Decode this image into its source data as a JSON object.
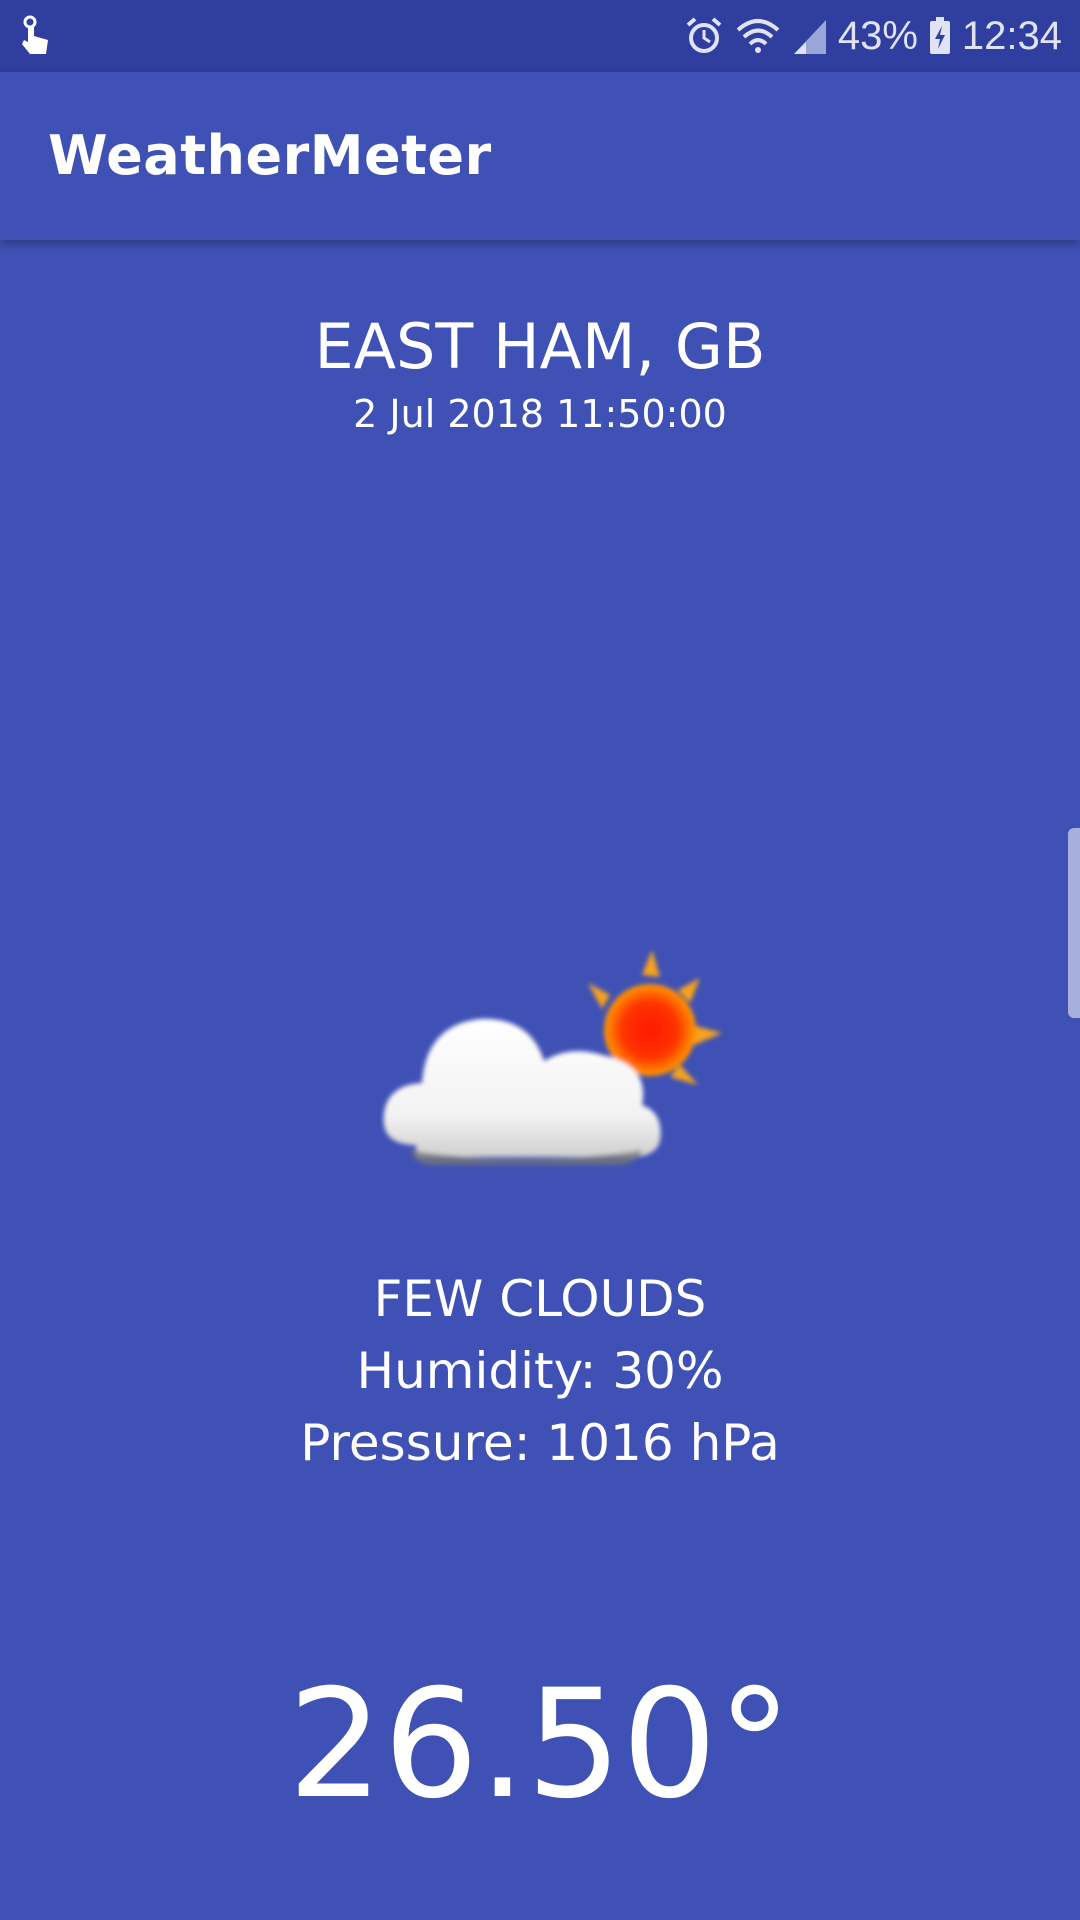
{
  "status_bar": {
    "battery_percent": "43%",
    "time": "12:34",
    "icons": [
      "touch-icon",
      "alarm-icon",
      "wifi-icon",
      "signal-icon",
      "battery-charging-icon"
    ]
  },
  "app_bar": {
    "title": "WeatherMeter"
  },
  "weather": {
    "location": "EAST HAM, GB",
    "datetime": "2 Jul 2018 11:50:00",
    "condition": "FEW CLOUDS",
    "humidity": "Humidity: 30%",
    "pressure": "Pressure: 1016 hPa",
    "temperature": "26.50°",
    "icon": "few-clouds-icon"
  },
  "colors": {
    "primary": "#3F51B5",
    "primary_dark": "#303F9F",
    "text": "#FFFFFF"
  }
}
